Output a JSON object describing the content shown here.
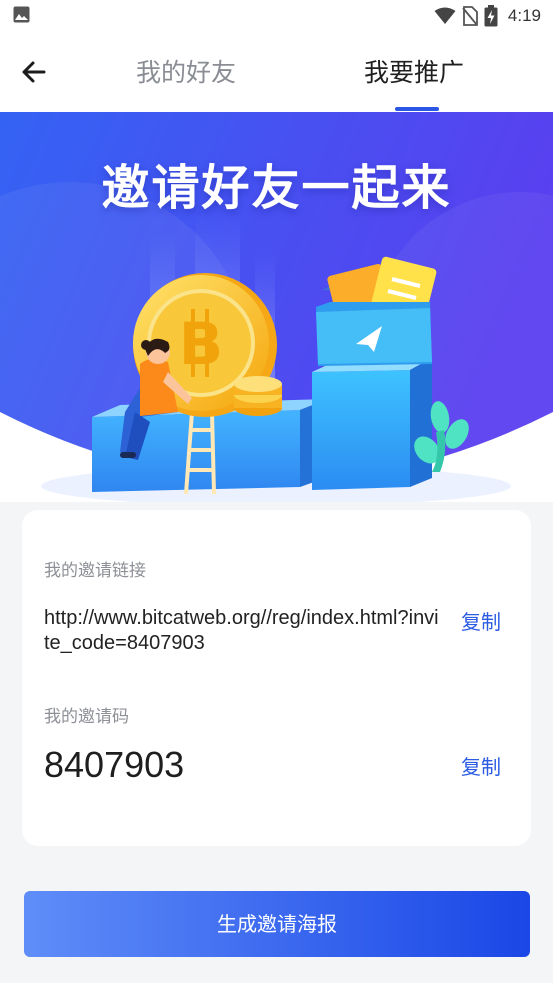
{
  "status_bar": {
    "time": "4:19",
    "icons": [
      "image-icon",
      "wifi-icon",
      "no-sim-icon",
      "battery-charging-icon"
    ]
  },
  "header": {
    "back_icon": "arrow-left-icon",
    "tabs": [
      {
        "label": "我的好友",
        "active": false
      },
      {
        "label": "我要推广",
        "active": true
      }
    ],
    "accent_color": "#2a55e5"
  },
  "banner": {
    "title": "邀请好友一起来",
    "illustration": "bitcoin-coin-person-folder-illustration"
  },
  "invite": {
    "link_label": "我的邀请链接",
    "link_value": "http://www.bitcatweb.org//reg/index.html?invite_code=8407903",
    "link_copy_label": "复制",
    "code_label": "我的邀请码",
    "code_value": "8407903",
    "code_copy_label": "复制"
  },
  "actions": {
    "generate_poster_label": "生成邀请海报",
    "button_colors": [
      "#5f8df8",
      "#1a47e6"
    ]
  }
}
